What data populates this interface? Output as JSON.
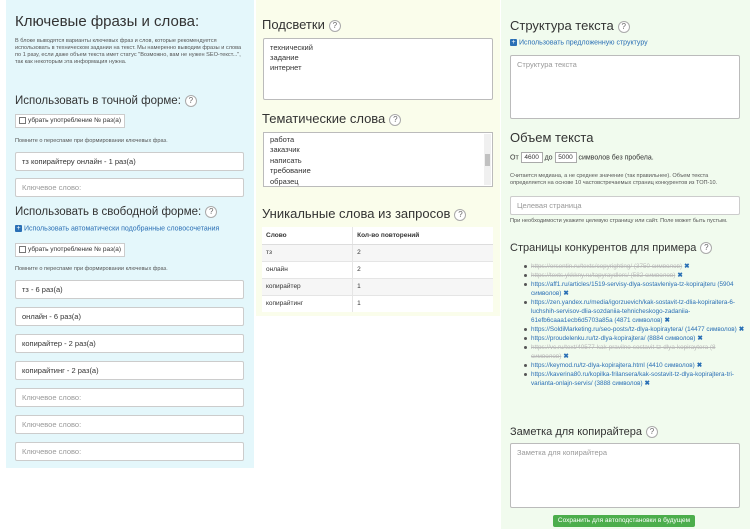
{
  "left": {
    "title": "Ключевые фразы и слова:",
    "intro": "В блоке выводятся варианты ключевых фраз и слов, которые рекомендуется использовать в техническом задании на текст. Мы намеренно выводим фразы и слова по 1 разу, если даже объем текста имет статус \"Возможно, вам не нужен SEO-текст...\", так как некоторым эта информация нужна.",
    "exact": {
      "title": "Использовать в точной форме:",
      "checkbox_label": "убрать употребление № раз(а)",
      "hint": "Помните о переспаме при формировании ключевых фраз.",
      "fields": [
        {
          "value": "тз копирайтеру онлайн - 1 раз(а)",
          "placeholder": ""
        },
        {
          "value": "",
          "placeholder": "Ключевое слово:"
        }
      ]
    },
    "free": {
      "title": "Использовать в свободной форме:",
      "auto_link": "Использовать автоматически подобранные словосочетания",
      "checkbox_label": "убрать употребление № раз(а)",
      "hint": "Помните о переспаме при формировании ключевых фраз.",
      "fields": [
        {
          "value": "тз - 6 раз(а)",
          "placeholder": ""
        },
        {
          "value": "онлайн - 6 раз(а)",
          "placeholder": ""
        },
        {
          "value": "копирайтер - 2 раз(а)",
          "placeholder": ""
        },
        {
          "value": "копирайтинг - 2 раз(а)",
          "placeholder": ""
        },
        {
          "value": "",
          "placeholder": "Ключевое слово:"
        },
        {
          "value": "",
          "placeholder": "Ключевое слово:"
        },
        {
          "value": "",
          "placeholder": "Ключевое слово:"
        }
      ]
    }
  },
  "mid": {
    "highlights": {
      "title": "Подсветки",
      "lines": [
        "технический",
        "задание",
        "интернет"
      ]
    },
    "thematic": {
      "title": "Тематические слова",
      "lines": [
        "работа",
        "заказчик",
        "написать",
        "требование",
        "образец"
      ]
    },
    "unique": {
      "title": "Уникальные слова из запросов",
      "headers": [
        "Слово",
        "Кол-во повторений"
      ],
      "rows": [
        [
          "тз",
          "2"
        ],
        [
          "онлайн",
          "2"
        ],
        [
          "копирайтер",
          "1"
        ],
        [
          "копирайтинг",
          "1"
        ]
      ]
    }
  },
  "right": {
    "structure": {
      "title": "Структура текста",
      "suggest_link": "Использовать предложенную структуру",
      "placeholder": "Структура текста"
    },
    "volume": {
      "title": "Объем текста",
      "from_label": "От",
      "from_value": "4600",
      "to_label": "до",
      "to_value": "5000",
      "unit_label": "символов без пробела.",
      "note": "Считается медиана, а не среднее значение (так правильнее). Объем текста определяется на основе 10 частовстречаемых страниц конкурентов из ТОП-10.",
      "target_placeholder": "Целевая страница",
      "target_hint": "При необходимости укажите целевую страницу или сайт. Поле может быть пустым."
    },
    "competitors": {
      "title": "Страницы конкурентов для примера",
      "items": [
        {
          "text": "https://ersentin.ru/texts/copyrighting/",
          "count": "(3750 символов)",
          "struck": true
        },
        {
          "text": "https://texts.ykkkny.ru/tapyraydlers/",
          "count": "(582 символов)",
          "struck": true
        },
        {
          "text": "https://aff1.ru/articles/1519-servisy-dlya-sostavleniya-tz-kopirajteru",
          "count": "(5904 символов)",
          "struck": false
        },
        {
          "text": "https://zen.yandex.ru/media/igorzuevich/kak-sostavit-tz-dlia-kopiraitera-6-luchshih-servisov-dlia-sozdaniia-tehnicheskogo-zadaniia-61efb6caaa1ecb6d5703a85a",
          "count": "(4871 символов)",
          "struck": false
        },
        {
          "text": "https://SoldiMarketing.ru/seo-posts/tz-dlya-kopiraytera/",
          "count": "(14477 символов)",
          "struck": false
        },
        {
          "text": "https://proudelenku.ru/tz-dlya-kopirajtera/",
          "count": "(8884 символов)",
          "struck": false
        },
        {
          "text": "https://vc.ru/text/40577-kak-pravilno-sostavit-tz-dlya-kopiraytera",
          "count": "(8 символов)",
          "struck": true
        },
        {
          "text": "https://keymod.ru/tz-dlya-kopirajtera.html",
          "count": "(4410 символов)",
          "struck": false
        },
        {
          "text": "https://kaverina80.ru/kopilka-frilansera/kak-sostavit-tz-dlya-kopirajtera-tri-varianta-onlajn-servis/",
          "count": "(3888 символов)",
          "struck": false
        }
      ]
    },
    "note": {
      "title": "Заметка для копирайтера",
      "placeholder": "Заметка для копирайтера"
    },
    "save_button": "Сохранить для автоподстановки в будущем"
  },
  "icons": {
    "help": "question-circle-icon",
    "plus": "plus-square-icon",
    "remove": "remove-x-icon"
  },
  "colors": {
    "left_bg": "#e4f7fb",
    "mid_bg": "#fafdeb",
    "right_bg": "#f1fbee",
    "link": "#2a6fb5",
    "save_button": "#4cae4c"
  }
}
